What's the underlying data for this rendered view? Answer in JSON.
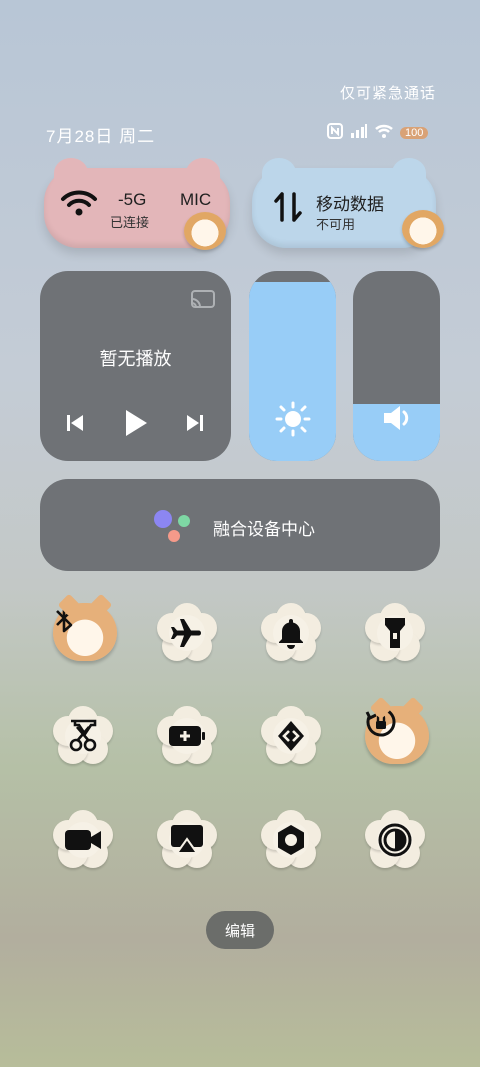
{
  "status_bar": {
    "emergency_text": "仅可紧急通话",
    "date": "7月28日 周二",
    "battery_text": "100"
  },
  "wifi_card": {
    "title": "-5G",
    "title_suffix": "MIC",
    "subtitle": "已连接",
    "icon": "wifi-icon"
  },
  "mobile_card": {
    "title": "移动数据",
    "subtitle": "不可用",
    "icon": "data-transfer-icon"
  },
  "media": {
    "title": "暂无播放",
    "cast_icon": "cast-icon"
  },
  "sliders": {
    "brightness_level": 0.94,
    "volume_level": 0.3
  },
  "fusion": {
    "label": "融合设备中心"
  },
  "toggles": [
    {
      "name": "bluetooth",
      "icon": "bluetooth-icon",
      "style": "cat"
    },
    {
      "name": "airplane-mode",
      "icon": "airplane-icon",
      "style": "flower"
    },
    {
      "name": "sound",
      "icon": "bell-icon",
      "style": "flower"
    },
    {
      "name": "flashlight",
      "icon": "flashlight-icon",
      "style": "flower"
    },
    {
      "name": "screenshot",
      "icon": "scissors-icon",
      "style": "flower"
    },
    {
      "name": "battery-saver",
      "icon": "battery-plus-icon",
      "style": "flower"
    },
    {
      "name": "vpn",
      "icon": "code-shield-icon",
      "style": "flower"
    },
    {
      "name": "auto-rotate",
      "icon": "rotation-lock-icon",
      "style": "cat"
    },
    {
      "name": "screen-record",
      "icon": "video-camera-icon",
      "style": "flower"
    },
    {
      "name": "screen-cast",
      "icon": "airplay-icon",
      "style": "flower"
    },
    {
      "name": "eye-comfort",
      "icon": "hexagon-nut-icon",
      "style": "flower"
    },
    {
      "name": "dark-mode",
      "icon": "contrast-icon",
      "style": "flower"
    }
  ],
  "edit_button": {
    "label": "编辑"
  }
}
